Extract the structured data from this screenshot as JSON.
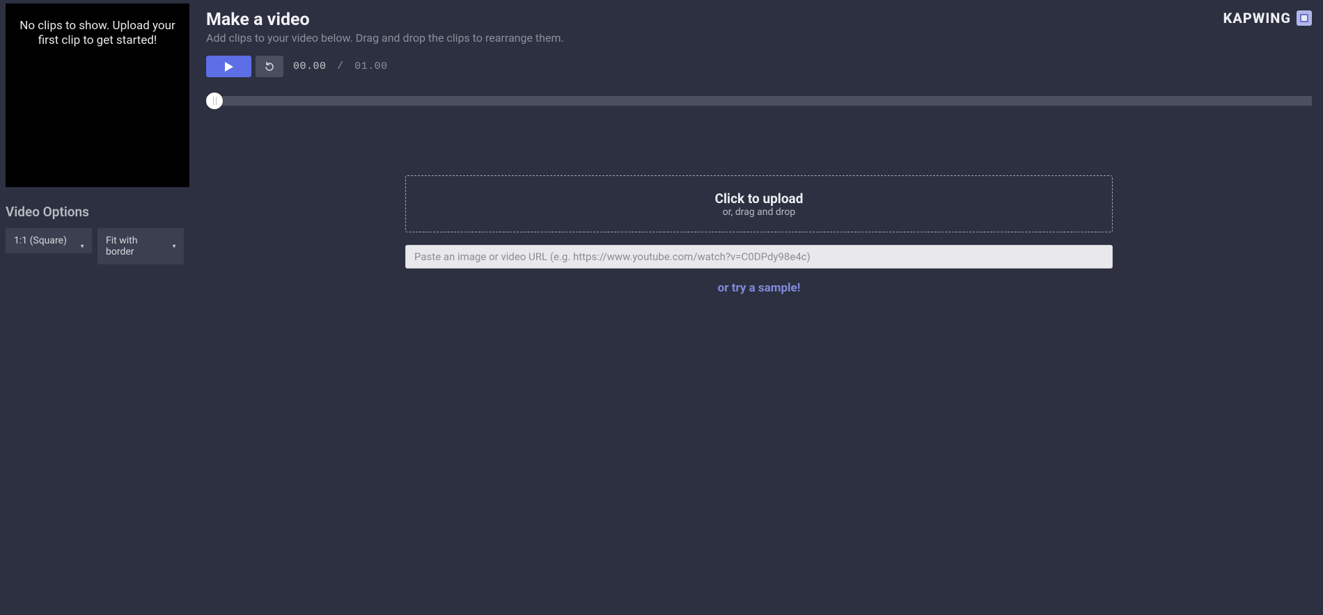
{
  "sidebar": {
    "preview_empty_text": "No clips to show. Upload your first clip to get started!",
    "options_title": "Video Options",
    "aspect_select": "1:1 (Square)",
    "fit_select": "Fit with border"
  },
  "header": {
    "title": "Make a video",
    "subtitle": "Add clips to your video below. Drag and drop the clips to rearrange them.",
    "brand": "KAPWING"
  },
  "playback": {
    "current_time": "00.00",
    "separator": "/",
    "total_time": "01.00"
  },
  "upload": {
    "click_label": "Click to upload",
    "drag_label": "or, drag and drop",
    "url_placeholder": "Paste an image or video URL (e.g. https://www.youtube.com/watch?v=C0DPdy98e4c)",
    "sample_text": "or try a sample!"
  }
}
